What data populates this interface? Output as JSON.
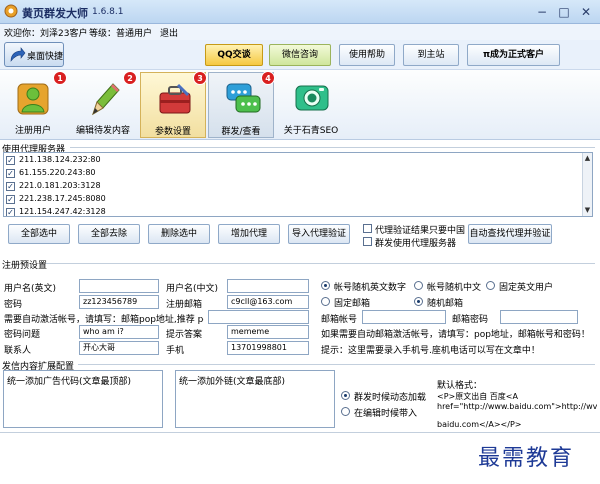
{
  "window": {
    "title": "黄页群发大师",
    "version": "1.6.8.1",
    "minimize": "−",
    "restore": "□",
    "close": "✕"
  },
  "info": {
    "welcome": "欢迎你：刘泽23客户",
    "level": "等级：普通用户",
    "logout": "退出"
  },
  "toolbar": {
    "desktop": "桌面快捷",
    "qq": "QQ交谈",
    "wechat": "微信咨询",
    "help": "使用帮助",
    "site": "到主站",
    "vip": "π成为正式客户"
  },
  "iconbar": [
    {
      "label": "注册用户",
      "badge": "1"
    },
    {
      "label": "编辑待发内容",
      "badge": "2"
    },
    {
      "label": "参数设置",
      "badge": "3"
    },
    {
      "label": "群发/查看",
      "badge": "4"
    },
    {
      "label": "关于石青SEO",
      "badge": ""
    }
  ],
  "proxy": {
    "header": "使用代理服务器",
    "items": [
      "211.138.124.232:80",
      "61.155.220.243:80",
      "221.0.181.203:3128",
      "221.238.17.245:8080",
      "121.154.247.42:3128"
    ],
    "select_all": "全部选中",
    "deselect_all": "全部去除",
    "delete_selected": "删除选中",
    "add_proxy": "增加代理",
    "import_verify": "导入代理验证",
    "opt_china": "代理验证结果只要中国",
    "opt_group": "群发使用代理服务器",
    "auto_find": "自动查找代理并验证"
  },
  "register": {
    "header": "注册预设置",
    "username_en": "用户名(英文)",
    "username_cn": "用户名(中文)",
    "password": "密码",
    "password_val": "zz123456789",
    "reg_email": "注册邮箱",
    "reg_email_val": "c9cll@163.com",
    "auto_email_hint": "需要自动激活帐号，请填写：邮箱pop地址,推荐 pop.163.com",
    "email_account": "邮箱帐号",
    "email_password": "邮箱密码",
    "pwd_question": "密码问题",
    "pwd_question_val": "who am i?",
    "pwd_answer": "提示答案",
    "pwd_answer_val": "mememe",
    "contact": "联系人",
    "contact_val": "开心大哥",
    "phone": "手机",
    "phone_val": "13701998801",
    "radio_acc_en": "帐号随机英文数字",
    "radio_acc_cn": "帐号随机中文",
    "radio_acc_fixed": "固定英文用户",
    "radio_mail_fixed": "固定邮箱",
    "radio_mail_random": "随机邮箱",
    "note_activate": "如果需要自动邮箱激活帐号，请填写：pop地址，邮箱帐号和密码！",
    "note_phone": "提示：这里需要录入手机号.座机电话可以写在文章中！"
  },
  "content": {
    "header": "发信内容扩展配置",
    "ad_label": "统一添加广告代码(文章最顶部)",
    "link_label": "统一添加外链(文章最底部)",
    "radio_dynamic": "群发时候动态加载",
    "radio_edit": "在编辑时候带入",
    "format_title": "默认格式：",
    "format_line1": "<P>原文出自 百度<A",
    "format_line2": "href=\"http://www.baidu.com\">http://wv",
    "format_line3": "baidu.com</A></P>"
  },
  "watermark": "最需教育"
}
